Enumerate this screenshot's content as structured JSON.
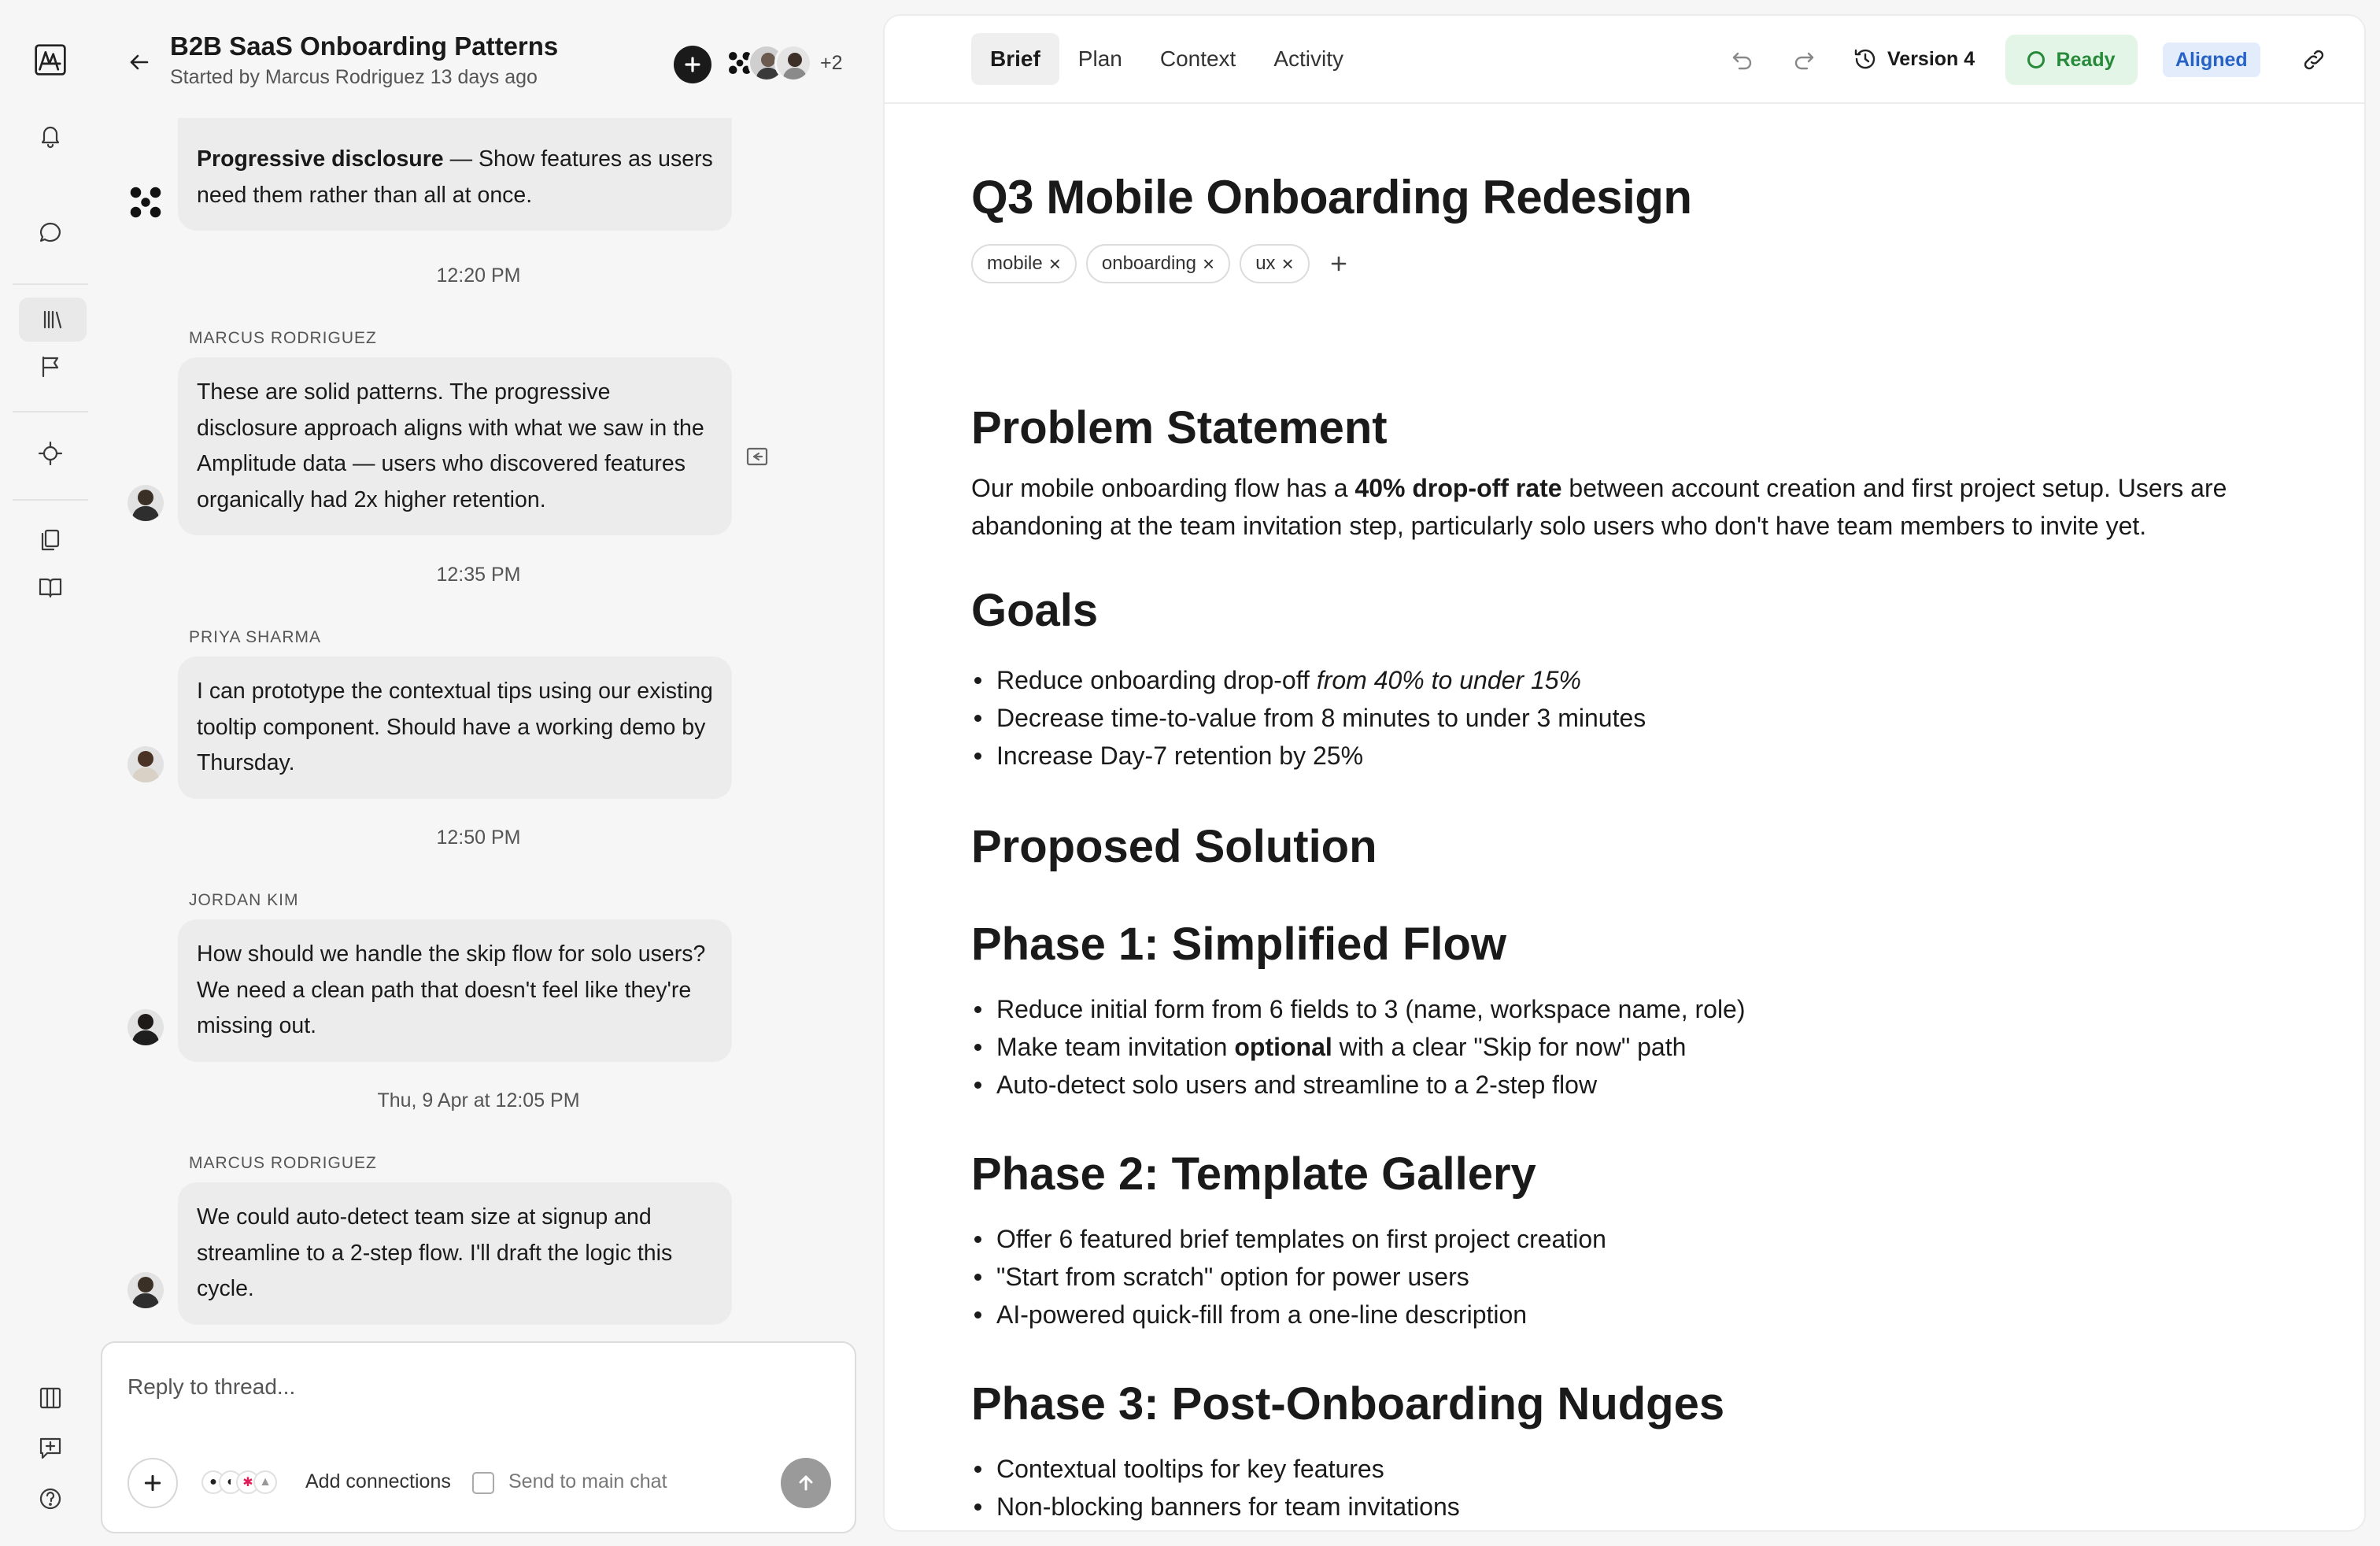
{
  "thread": {
    "title": "B2B SaaS Onboarding Patterns",
    "subtitle": "Started by Marcus Rodriguez 13 days ago",
    "extra_participants": "+2",
    "messages": [
      {
        "bold": "Progressive disclosure",
        "text": " — Show features as users need them rather than all at once."
      },
      {
        "time": "12:20 PM",
        "author": "MARCUS RODRIGUEZ",
        "text": "These are solid patterns. The progressive disclosure approach aligns with what we saw in the Amplitude data — users who discovered features organically had 2x higher retention."
      },
      {
        "time": "12:35 PM",
        "author": "PRIYA SHARMA",
        "text": "I can prototype the contextual tips using our existing tooltip component. Should have a working demo by Thursday."
      },
      {
        "time": "12:50 PM",
        "author": "JORDAN KIM",
        "text": "How should we handle the skip flow for solo users? We need a clean path that doesn't feel like they're missing out."
      },
      {
        "time": "Thu, 9 Apr at 12:05 PM",
        "author": "MARCUS RODRIGUEZ",
        "text": "We could auto-detect team size at signup and streamline to a 2-step flow. I'll draft the logic this cycle."
      }
    ],
    "composer": {
      "placeholder": "Reply to thread...",
      "add_connections": "Add connections",
      "send_to_main": "Send to main chat"
    }
  },
  "doc": {
    "tabs": [
      "Brief",
      "Plan",
      "Context",
      "Activity"
    ],
    "active_tab": "Brief",
    "version": "Version 4",
    "status": "Ready",
    "alignment": "Aligned",
    "status_color": "#268a3a",
    "alignment_color": "#2763c6",
    "title": "Q3 Mobile Onboarding Redesign",
    "tags": [
      "mobile",
      "onboarding",
      "ux"
    ],
    "problem": {
      "heading": "Problem Statement",
      "pre": "Our mobile onboarding flow has a ",
      "bold": "40% drop-off rate",
      "post": " between account creation and first project setup. Users are abandoning at the team invitation step, particularly solo users who don't have team members to invite yet."
    },
    "goals": {
      "heading": "Goals",
      "g1_pre": "Reduce onboarding drop-off ",
      "g1_italic": "from 40% to under 15%",
      "g2": "Decrease time-to-value from 8 minutes to under 3 minutes",
      "g3": "Increase Day-7 retention by 25%"
    },
    "solution_heading": "Proposed Solution",
    "phase1": {
      "heading": "Phase 1: Simplified Flow",
      "i1": "Reduce initial form from 6 fields to 3 (name, workspace name, role)",
      "i2_pre": "Make team invitation ",
      "i2_bold": "optional",
      "i2_post": " with a clear \"Skip for now\" path",
      "i3": "Auto-detect solo users and streamline to a 2-step flow"
    },
    "phase2": {
      "heading": "Phase 2: Template Gallery",
      "i1": "Offer 6 featured brief templates on first project creation",
      "i2": "\"Start from scratch\" option for power users",
      "i3": "AI-powered quick-fill from a one-line description"
    },
    "phase3": {
      "heading": "Phase 3: Post-Onboarding Nudges",
      "i1": "Contextual tooltips for key features",
      "i2": "Non-blocking banners for team invitations"
    }
  }
}
